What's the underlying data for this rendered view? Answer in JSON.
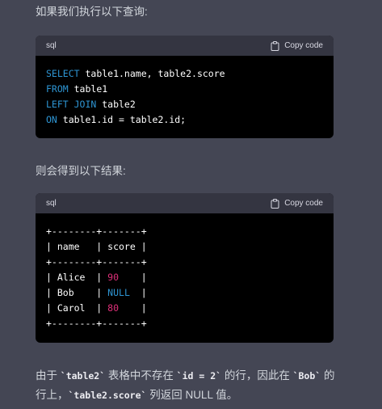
{
  "paragraphs": {
    "intro": "如果我们执行以下查询:",
    "result_intro": "则会得到以下结果:",
    "explanation": {
      "t1": "由于 ",
      "c1": "`table2`",
      "t2": " 表格中不存在 ",
      "c2": "`id = 2`",
      "t3": " 的行，因此在 ",
      "c3": "`Bob`",
      "t4": " 的行上，",
      "c4": "`table2.score`",
      "t5": " 列返回 NULL 值。"
    }
  },
  "code_blocks": [
    {
      "language": "sql",
      "copy_label": "Copy code",
      "lines": [
        [
          [
            "kw",
            "SELECT"
          ],
          [
            "pl",
            " table1.name, table2.score"
          ]
        ],
        [
          [
            "kw",
            "FROM"
          ],
          [
            "pl",
            " table1"
          ]
        ],
        [
          [
            "kw",
            "LEFT JOIN"
          ],
          [
            "pl",
            " table2"
          ]
        ],
        [
          [
            "kw",
            "ON"
          ],
          [
            "pl",
            " table1.id = table2.id;"
          ]
        ]
      ]
    },
    {
      "language": "sql",
      "copy_label": "Copy code",
      "lines": [
        [
          [
            "pl",
            "+--------+-------+"
          ]
        ],
        [
          [
            "pl",
            "| name   | score |"
          ]
        ],
        [
          [
            "pl",
            "+--------+-------+"
          ]
        ],
        [
          [
            "pl",
            "| Alice  | "
          ],
          [
            "num",
            "90"
          ],
          [
            "pl",
            "    |"
          ]
        ],
        [
          [
            "pl",
            "| Bob    | "
          ],
          [
            "nul",
            "NULL"
          ],
          [
            "pl",
            "  |"
          ]
        ],
        [
          [
            "pl",
            "| Carol  | "
          ],
          [
            "num",
            "80"
          ],
          [
            "pl",
            "    |"
          ]
        ],
        [
          [
            "pl",
            "+--------+-------+"
          ]
        ]
      ]
    }
  ],
  "icons": {
    "copy": "clipboard-icon"
  },
  "colors": {
    "background": "#444654",
    "code_background": "#000000",
    "code_header": "#343541",
    "keyword": "#2e95d3",
    "number": "#df3079"
  }
}
